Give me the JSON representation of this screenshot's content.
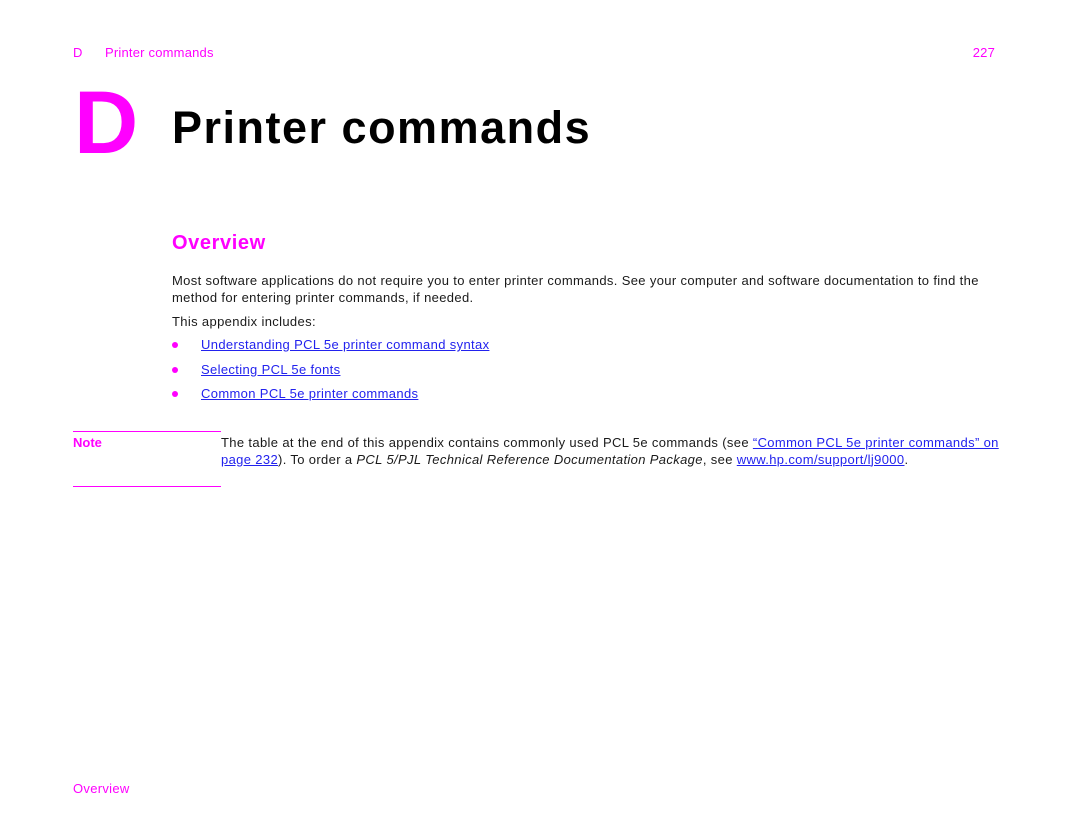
{
  "running_header": {
    "chapter_letter": "D",
    "chapter_title": "Printer commands",
    "page_number": "227"
  },
  "chapter_title": {
    "letter": "D",
    "text": "Printer commands"
  },
  "section": {
    "heading": "Overview",
    "paragraph1": "Most software applications do not require you to enter printer commands. See your computer and software documentation to find the method for entering printer commands, if needed.",
    "paragraph2": "This appendix includes:",
    "bullets": [
      {
        "label": "Understanding PCL 5e printer command syntax"
      },
      {
        "label": "Selecting PCL 5e fonts"
      },
      {
        "label": "Common PCL 5e printer commands"
      }
    ]
  },
  "note": {
    "label": "Note",
    "text_before_link": "The table at the end of this appendix contains commonly used PCL 5e commands (see ",
    "link1": "“Common PCL 5e printer commands” on page 232",
    "text_after_link1": "). To order a ",
    "italic_title": "PCL 5/PJL Technical Reference Documentation Package",
    "text_before_link2": ", see ",
    "link2": "www.hp.com/support/lj9000",
    "text_end": "."
  },
  "running_footer": {
    "text": "Overview"
  },
  "colors": {
    "accent": "#ff00ff",
    "link": "#2222ee",
    "text": "#1a1a1a"
  }
}
